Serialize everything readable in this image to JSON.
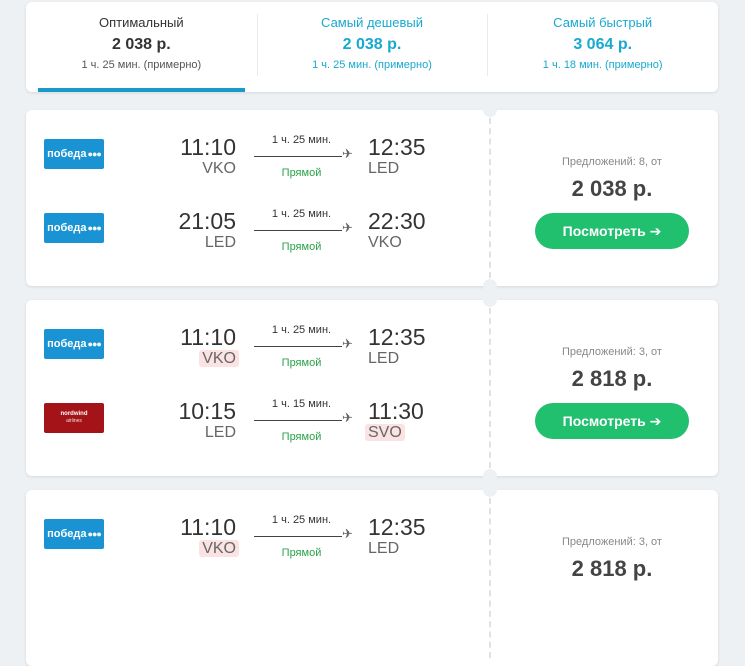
{
  "tabs": [
    {
      "label": "Оптимальный",
      "price": "2 038 р.",
      "duration": "1 ч. 25 мин. (примерно)"
    },
    {
      "label": "Самый дешевый",
      "price": "2 038 р.",
      "duration": "1 ч. 25 мин. (примерно)"
    },
    {
      "label": "Самый быстрый",
      "price": "3 064 р.",
      "duration": "1 ч. 18 мин. (примерно)"
    }
  ],
  "tickets": [
    {
      "segments": [
        {
          "airline": "победа",
          "dep_time": "11:10",
          "dep_airport": "VKO",
          "duration": "1 ч. 25 мин.",
          "type": "Прямой",
          "arr_time": "12:35",
          "arr_airport": "LED"
        },
        {
          "airline": "победа",
          "dep_time": "21:05",
          "dep_airport": "LED",
          "duration": "1 ч. 25 мин.",
          "type": "Прямой",
          "arr_time": "22:30",
          "arr_airport": "VKO"
        }
      ],
      "offers": "Предложений: 8, от",
      "price": "2 038 р.",
      "button": "Посмотреть ➔"
    },
    {
      "segments": [
        {
          "airline": "победа",
          "dep_time": "11:10",
          "dep_airport": "VKO",
          "duration": "1 ч. 25 мин.",
          "type": "Прямой",
          "arr_time": "12:35",
          "arr_airport": "LED"
        },
        {
          "airline": "nordwind",
          "airline_sub": "airlines",
          "dep_time": "10:15",
          "dep_airport": "LED",
          "duration": "1 ч. 15 мин.",
          "type": "Прямой",
          "arr_time": "11:30",
          "arr_airport": "SVO"
        }
      ],
      "offers": "Предложений: 3, от",
      "price": "2 818 р.",
      "button": "Посмотреть ➔"
    },
    {
      "segments": [
        {
          "airline": "победа",
          "dep_time": "11:10",
          "dep_airport": "VKO",
          "duration": "1 ч. 25 мин.",
          "type": "Прямой",
          "arr_time": "12:35",
          "arr_airport": "LED"
        }
      ],
      "offers": "Предложений: 3, от",
      "price": "2 818 р."
    }
  ],
  "colors": {
    "accent": "#18a9cf",
    "button": "#21c06f",
    "direct": "#29a349",
    "airport_highlight": "#fbe3e3",
    "pobeda": "#1993d3",
    "nordwind": "#a31317"
  },
  "icons": {
    "plane": "airplane-icon",
    "arrow": "arrow-right-icon"
  }
}
